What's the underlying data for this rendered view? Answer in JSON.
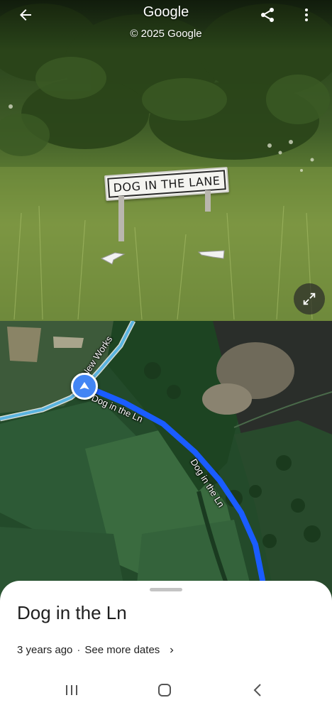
{
  "streetview": {
    "title": "Google",
    "copyright": "© 2025 Google",
    "sign_text": "DOG IN THE LANE",
    "icons": {
      "back": "arrow-left-icon",
      "share": "share-icon",
      "more": "more-vert-icon",
      "expand": "expand-icon"
    }
  },
  "map": {
    "road_labels": {
      "new_works": "New Works",
      "dog_in_the_ln_1": "Dog in the Ln",
      "dog_in_the_ln_2": "Dog in the Ln"
    },
    "colors": {
      "selected_road": "#1a5cff",
      "other_road": "#5ab4e0",
      "marker": "#4285f4"
    }
  },
  "sheet": {
    "title": "Dog in the Ln",
    "date": "3 years ago",
    "separator": "·",
    "see_more": "See more dates"
  },
  "system_nav": {
    "recents": "recents-icon",
    "home": "home-icon",
    "back": "back-icon"
  }
}
